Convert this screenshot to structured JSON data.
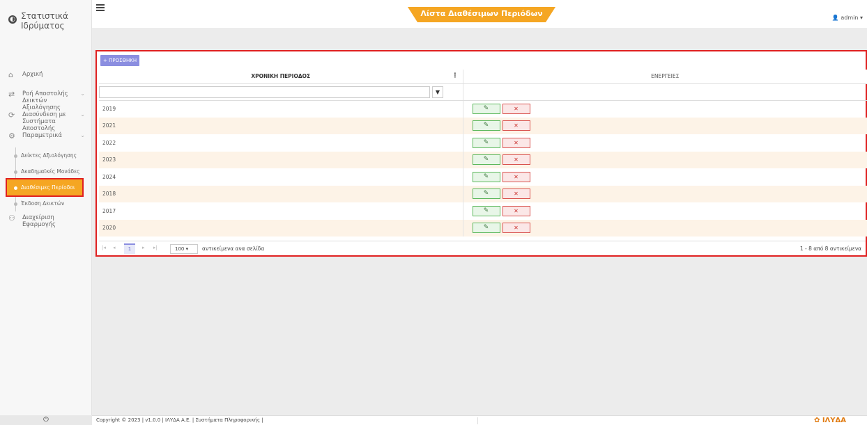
{
  "app": {
    "brand_line1": "Στατιστικά",
    "brand_line2": "Ιδρύματος",
    "page_title": "Λίστα Διαθέσιμων Περιόδων",
    "user": "admin",
    "accent_color": "#f5a623"
  },
  "sidebar": {
    "items": [
      {
        "icon": "home-icon",
        "label": "Αρχική"
      },
      {
        "icon": "transfer-icon",
        "label": "Ροή Αποστολής Δεικτών Αξιολόγησης"
      },
      {
        "icon": "sync-icon",
        "label": "Διασύνδεση με Συστήματα Αποστολής"
      },
      {
        "icon": "gear-icon",
        "label": "Παραμετρικά"
      }
    ],
    "sub_items": [
      {
        "label": "Δείκτες Αξιολόγησης"
      },
      {
        "label": "Ακαδημαϊκές Μονάδες"
      },
      {
        "label": "Διαθέσιμες Περίοδοι",
        "active": true
      },
      {
        "label": "Έκδοση Δεικτών"
      }
    ],
    "admin_item": {
      "icon": "users-icon",
      "label": "Διαχείριση Εφαρμογής"
    }
  },
  "toolbar": {
    "add_label": "+ ΠΡΟΣΘΗΚΗ"
  },
  "grid": {
    "columns": [
      "ΧΡΟΝΙΚΗ ΠΕΡΙΟΔΟΣ",
      "ΕΝΕΡΓΕΙΕΣ"
    ],
    "rows": [
      "2019",
      "2021",
      "2022",
      "2023",
      "2024",
      "2018",
      "2017",
      "2020"
    ]
  },
  "pager": {
    "current_page": "1",
    "page_size": "100",
    "per_page_label": "αντικείμενα ανα σελίδα",
    "info": "1 - 8 από 8 αντικείμενα"
  },
  "footer": {
    "copyright": "Copyright © 2023 | v1.0.0 | ΙΛΥΔΑ Α.Ε. | Συστήματα Πληροφορικής |",
    "logo": "ΙΛΥΔΑ"
  }
}
